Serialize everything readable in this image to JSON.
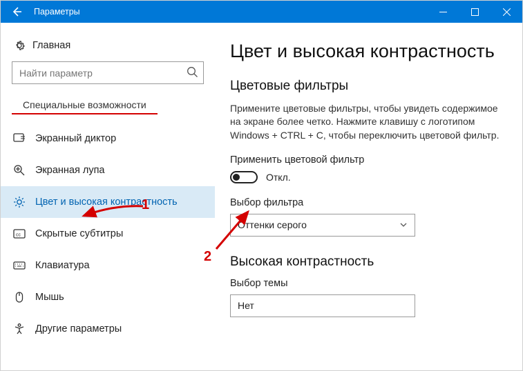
{
  "titlebar": {
    "title": "Параметры"
  },
  "sidebar": {
    "home": "Главная",
    "search_placeholder": "Найти параметр",
    "section": "Специальные возможности",
    "items": [
      {
        "label": "Экранный диктор"
      },
      {
        "label": "Экранная лупа"
      },
      {
        "label": "Цвет и высокая контрастность"
      },
      {
        "label": "Скрытые субтитры"
      },
      {
        "label": "Клавиатура"
      },
      {
        "label": "Мышь"
      },
      {
        "label": "Другие параметры"
      }
    ]
  },
  "main": {
    "heading": "Цвет и высокая контрастность",
    "filters_heading": "Цветовые фильтры",
    "filters_desc": "Примените цветовые фильтры, чтобы увидеть содержимое на экране более четко. Нажмите клавишу с логотипом Windows + CTRL + C, чтобы переключить цветовой фильтр.",
    "apply_label": "Применить цветовой фильтр",
    "toggle_state": "Откл.",
    "filter_choice_label": "Выбор фильтра",
    "filter_choice_value": "Оттенки серого",
    "contrast_heading": "Высокая контрастность",
    "theme_label": "Выбор темы",
    "theme_value": "Нет"
  },
  "annotations": {
    "one": "1",
    "two": "2"
  }
}
